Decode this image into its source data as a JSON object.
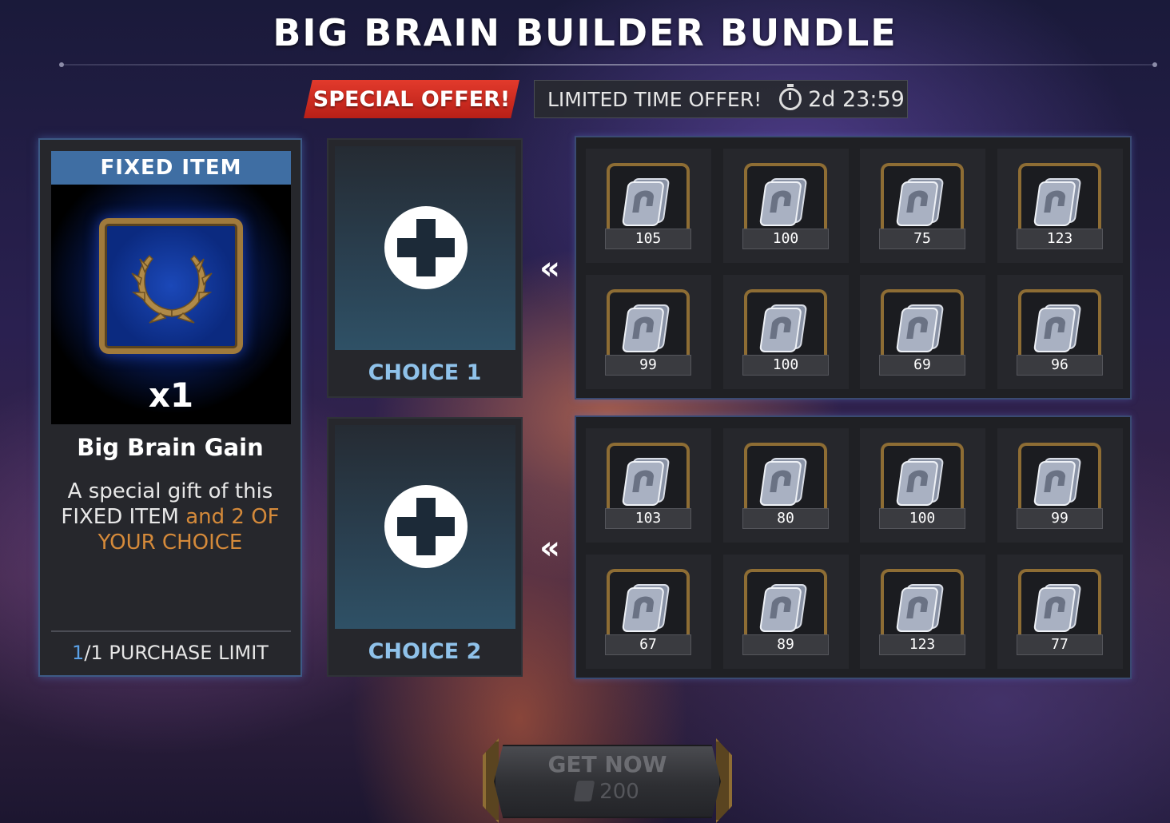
{
  "title": "BIG BRAIN BUILDER BUNDLE",
  "offer": {
    "special_label": "SPECIAL OFFER!",
    "limited_label": "LIMITED TIME OFFER!",
    "timer": "2d 23:59"
  },
  "fixed_item": {
    "header": "FIXED ITEM",
    "quantity": "x1",
    "name": "Big Brain Gain",
    "desc_part1": "A special gift of this FIXED ITEM",
    "desc_part2": " and 2 OF YOUR CHOICE",
    "limit_count": "1",
    "limit_total": "/1 PURCHASE LIMIT",
    "icon": "laurel-wreath-icon"
  },
  "choices": [
    {
      "label": "CHOICE 1",
      "icon": "plus-icon"
    },
    {
      "label": "CHOICE 2",
      "icon": "plus-icon"
    }
  ],
  "grid1": [
    "105",
    "100",
    "75",
    "123",
    "99",
    "100",
    "69",
    "96"
  ],
  "grid2": [
    "103",
    "80",
    "100",
    "99",
    "67",
    "89",
    "123",
    "77"
  ],
  "get_now": {
    "label": "GET NOW",
    "price": "200",
    "currency_icon": "unit-crystal-icon"
  },
  "colors": {
    "special_red": "#d42b20",
    "header_blue": "#3f6ea3",
    "choice_label": "#8fc2ea",
    "highlight_orange": "#d58a3a",
    "frame_gold": "#8e6d34"
  }
}
